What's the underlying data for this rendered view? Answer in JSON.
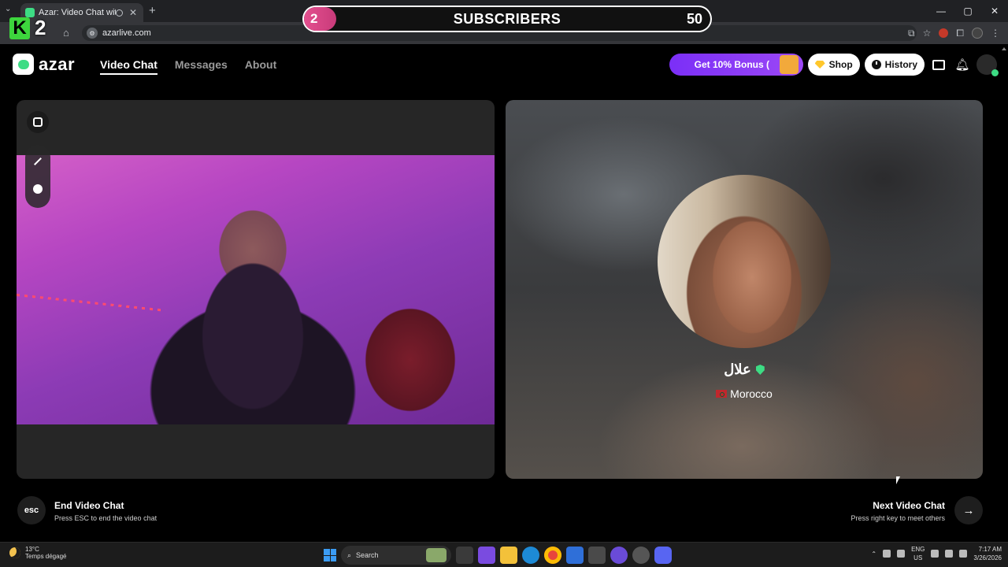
{
  "browser": {
    "tab_title": "Azar: Video Chat with New",
    "tab_close": "✕",
    "new_tab": "+",
    "tab_list": "⌄",
    "url": "azarlive.com",
    "window_controls": [
      "—",
      "▢",
      "✕"
    ]
  },
  "overlay": {
    "brand_letter": "K",
    "brand_number": "2",
    "subscriber_current": "2",
    "subscriber_label": "SUBSCRIBERS",
    "subscriber_goal": "50",
    "progress_fraction": 0.04
  },
  "azar": {
    "logo_text": "azar",
    "nav": {
      "video_chat": "Video Chat",
      "messages": "Messages",
      "about": "About"
    },
    "bonus_label": "Get 10% Bonus (",
    "shop_label": "Shop",
    "history_label": "History"
  },
  "peer": {
    "name": "علال",
    "country": "Morocco"
  },
  "hints": {
    "esc_key": "esc",
    "end_title": "End Video Chat",
    "end_sub": "Press ESC to end the video chat",
    "next_title": "Next Video Chat",
    "next_sub": "Press right key to meet others",
    "next_arrow": "→"
  },
  "taskbar": {
    "temp": "13°C",
    "weather_text": "Temps dégagé",
    "search_label": "Search",
    "lang_top": "ENG",
    "lang_bottom": "US",
    "time": "7:17 AM",
    "date": "3/26/2026"
  },
  "colors": {
    "brand_green": "#3ddc84",
    "bonus_purple": "#7b2ff7",
    "progress_pink": "#e44f8f"
  }
}
